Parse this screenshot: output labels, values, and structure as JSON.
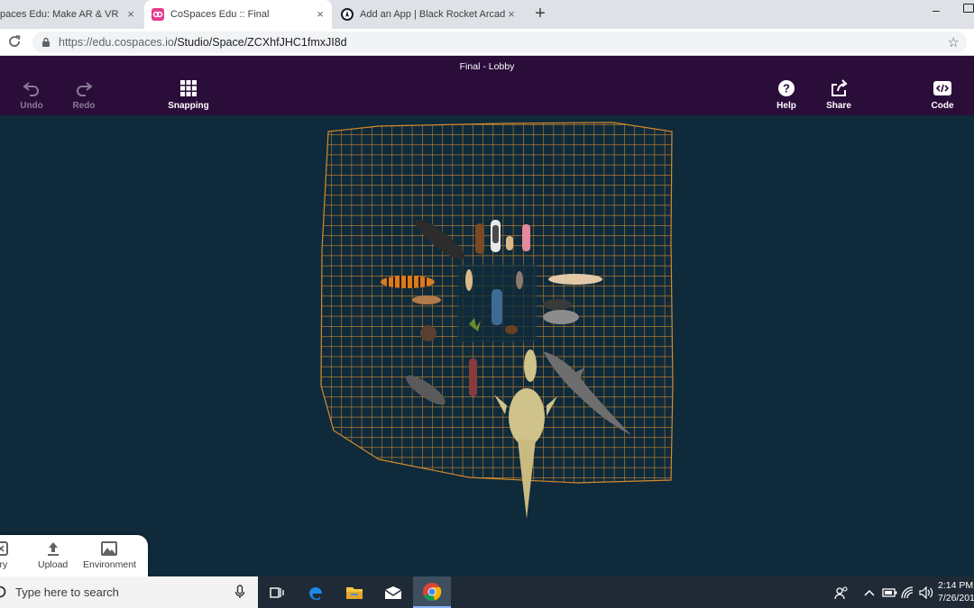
{
  "browser": {
    "tabs": [
      {
        "title": "paces Edu: Make AR & VR in",
        "favicon_color": "#8b5cf6"
      },
      {
        "title": "CoSpaces Edu :: Final",
        "favicon_color": "#e5398d"
      },
      {
        "title": "Add an App | Black Rocket Arcad",
        "favicon_color": "#1a1a2e"
      }
    ],
    "new_tab_label": "+",
    "minimize_label": "–",
    "close_label": "×",
    "url_host": "https://edu.cospaces.io",
    "url_path": "/Studio/Space/ZCXhfJHC1fmxJI8d",
    "star_label": "☆"
  },
  "editor": {
    "space_title": "Final - Lobby",
    "tools_left": [
      {
        "label": "Undo",
        "icon": "undo-icon",
        "enabled": false
      },
      {
        "label": "Redo",
        "icon": "redo-icon",
        "enabled": false
      },
      {
        "label": "Snapping",
        "icon": "grid-icon",
        "enabled": true
      }
    ],
    "tools_right": [
      {
        "label": "Help",
        "icon": "help-icon"
      },
      {
        "label": "Share",
        "icon": "share-icon"
      },
      {
        "label": "Code",
        "icon": "code-icon"
      }
    ],
    "drawer": [
      {
        "label": "ary",
        "icon": "library-icon"
      },
      {
        "label": "Upload",
        "icon": "upload-icon"
      },
      {
        "label": "Environment",
        "icon": "environment-icon"
      }
    ],
    "grid_color": "#d38a2e",
    "background_color": "#0f2a3a"
  },
  "taskbar": {
    "search_placeholder": "Type here to search",
    "time": "2:14 PM",
    "date": "7/26/2019",
    "apps": [
      "task-view-icon",
      "edge-icon",
      "file-explorer-icon",
      "mail-icon",
      "chrome-icon"
    ]
  }
}
